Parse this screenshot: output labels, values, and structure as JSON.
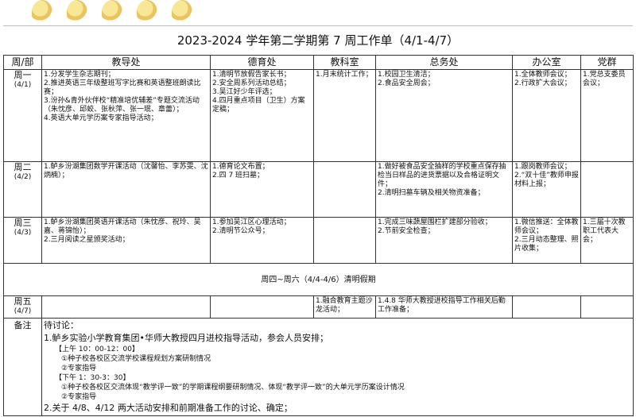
{
  "title": "2023-2024 学年第二学期第 7 周工作单（4/1-4/7）",
  "headers": [
    "周/部",
    "教导处",
    "德育处",
    "教科室",
    "总务处",
    "办公室",
    "党群"
  ],
  "rows": [
    {
      "day": "周一",
      "date": "(4/1)",
      "cells": [
        [
          "1.分发学生杂志期刊；",
          "2.推进英语三年级整班写字比赛和英语整班朗读比赛；",
          "3.汾孙&青外伙伴校“精准培优辅差”专题交流活动（朱忱彦、邱蛟、张秋萍、张一珉、章蕾）；",
          "4.英语大单元学历案专家指导活动；"
        ],
        [
          "1.清明节放假告家长书；",
          "2.安全周系列活动总结；",
          "3.吴江好少年评选；",
          "4.四月重点项目（卫生）方案定稿；"
        ],
        [
          "1.月末统计工作；"
        ],
        [
          "1.校园卫生清洁；",
          "2.食品安全周会；"
        ],
        [
          "1.全体教师会议；",
          "2.行政扩大会议；"
        ],
        [
          "1.党总支委员会议；"
        ]
      ]
    },
    {
      "day": "周二",
      "date": "(4/2)",
      "cells": [
        [
          "1.鲈乡汾湖集团数学开课活动（沈馨怡、李苏雯、沈炳楠）；"
        ],
        [
          "1.德育论文布置；",
          "2.四 7 班扫墓；"
        ],
        [],
        [
          "1.做好被食品安全抽样的学校重点保存抽检当日样品的进货票据以及合格证明文件；",
          "2.清明扫墓车辆及相关物资准备；"
        ],
        [
          "1.跟岗教师会议；",
          "2.“双十佳”教师申报材料上报；"
        ],
        []
      ]
    },
    {
      "day": "周三",
      "date": "(4/3)",
      "cells": [
        [
          "1.鲈乡汾湖集团英语开课活动（朱忱彦、祝玲、吴嘉、蒋锦怡）；",
          "2.三月阅读之星颁奖活动；"
        ],
        [
          "1.参加吴江区心理活动；",
          "2.清明节公众号；"
        ],
        [],
        [
          "1.完成三味蔬屋围栏扩建部分验收；",
          "2.节前安全检查；"
        ],
        [
          "1.微信推送：全体教师会议；",
          "2.三月动态整理、照片收集；"
        ],
        [
          "1.三届十次教职工代表大会；"
        ]
      ]
    }
  ],
  "holiday": "周四~周六（4/4-4/6）清明假期",
  "friday": {
    "day": "周五",
    "date": "(4/7)",
    "cells": [
      [],
      [],
      [
        "1.融合教育主题沙龙活动；"
      ],
      [
        "1.4.8 华师大教授进校指导工作相关后勤工作准备；"
      ],
      [],
      []
    ]
  },
  "notes": {
    "label": "备注",
    "heading": "待讨论：",
    "item1": "1.鲈乡实验小学教育集团•华师大教授四月进校指导活动，参会人员安排；",
    "am": "【上午 10：00-12：00】",
    "am1": "①种子校各校区交流学校课程规划方案研制情况",
    "am2": "②专家指导",
    "pm": "【下午 1：30-3：30】",
    "pm1": "①种子校各校区交流体现“教学评一致”的学期课程纲要研制情况、体现“教学评一致”的大单元学历案设计情况",
    "pm2": "②专家指导",
    "item2": "2.关于 4/8、4/12 两大活动安排和前期准备工作的讨论、确定；"
  }
}
